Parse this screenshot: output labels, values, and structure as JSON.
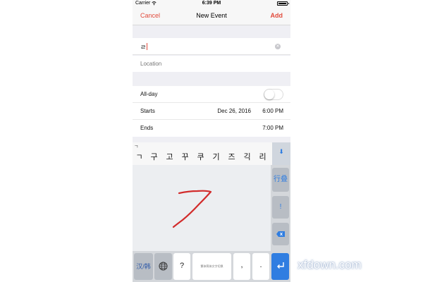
{
  "status_bar": {
    "carrier": "Carrier",
    "time": "6:39 PM",
    "battery_level": 1.0
  },
  "nav": {
    "cancel": "Cancel",
    "title": "New Event",
    "add": "Add"
  },
  "form": {
    "title_value": "ㄹ",
    "location_placeholder": "Location",
    "allday_label": "All-day",
    "allday_on": false,
    "starts_label": "Starts",
    "starts_date": "Dec 26, 2016",
    "starts_time": "6:00 PM",
    "ends_label": "Ends",
    "ends_time": "7:00 PM"
  },
  "keyboard": {
    "composing": "ㄱ",
    "candidates": [
      "ㄱ",
      "구",
      "고",
      "꾸",
      "쿠",
      "기",
      "즈",
      "긱",
      "리"
    ],
    "side_keys": {
      "layout": "行叠",
      "punct": "!"
    },
    "bottom": {
      "switch": "汉/韩",
      "question": "?",
      "space": "繁体简体文字切换",
      "comma": ",",
      "period": "."
    },
    "accent_color": "#2f7de1",
    "stroke_color": "#d22b2b"
  },
  "watermark": "xfdown.com",
  "colors": {
    "ios_red": "#e14a3b",
    "bg": "#efeff4"
  }
}
